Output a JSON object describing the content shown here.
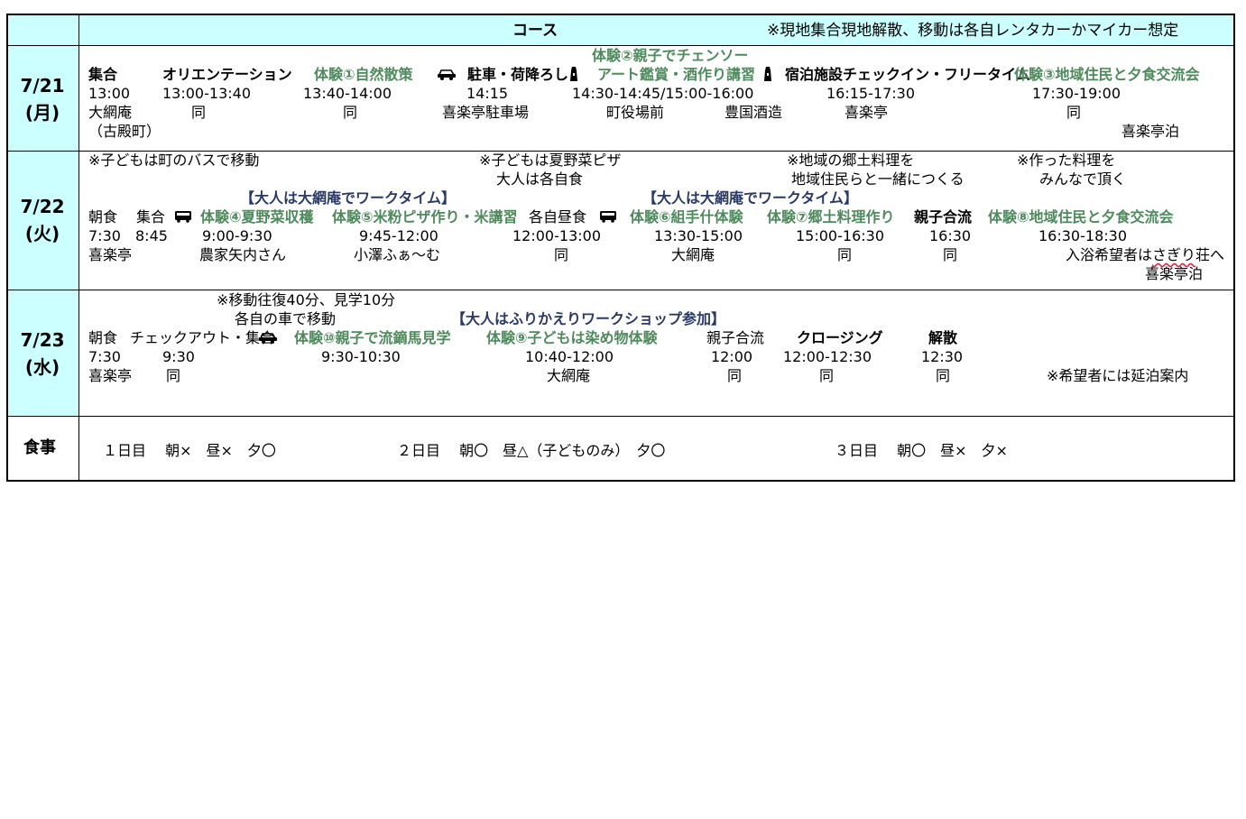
{
  "header": {
    "course_label": "コース",
    "note": "※現地集合現地解散、移動は各自レンタカーかマイカー想定"
  },
  "days": [
    {
      "date": "7/21",
      "weekday": "(月)"
    },
    {
      "date": "7/22",
      "weekday": "(火)"
    },
    {
      "date": "7/23",
      "weekday": "(水)"
    }
  ],
  "day1": {
    "top_label": "体験②親子でチェンソー",
    "items": [
      "集合",
      "オリエンテーション",
      "体験①自然散策",
      "駐車・荷降ろし",
      "アート鑑賞・酒作り講習",
      "宿泊施設チェックイン・フリータイム",
      "体験③地域住民と夕食交流会"
    ],
    "times": [
      "13:00",
      "13:00-13:40",
      "13:40-14:00",
      "14:15",
      "14:30-14:45/15:00-16:00",
      "16:15-17:30",
      "17:30-19:00"
    ],
    "places": [
      "大網庵",
      "同",
      "同",
      "喜楽亭駐車場",
      "町役場前",
      "豊国酒造",
      "喜楽亭",
      "同"
    ],
    "place_sub": "（古殿町）",
    "stay": "喜楽亭泊"
  },
  "day2": {
    "notes": [
      "※子どもは町のバスで移動",
      "※子どもは夏野菜ピザ",
      "大人は各自食",
      "※地域の郷土料理を",
      "地域住民らと一緒につくる",
      "※作った料理を",
      "みんなで頂く"
    ],
    "adult_notes": [
      "【大人は大網庵でワークタイム】",
      "【大人は大網庵でワークタイム】"
    ],
    "items": [
      "朝食",
      "集合",
      "体験④夏野菜収穫",
      "体験⑤米粉ピザ作り・米講習",
      "各自昼食",
      "体験⑥組手什体験",
      "体験⑦郷土料理作り",
      "親子合流",
      "体験⑧地域住民と夕食交流会"
    ],
    "times": [
      "7:30",
      "8:45",
      "9:00-9:30",
      "9:45-12:00",
      "12:00-13:00",
      "13:30-15:00",
      "15:00-16:30",
      "16:30",
      "16:30-18:30"
    ],
    "places": [
      "喜楽亭",
      "農家矢内さん",
      "小澤ふぁ～む",
      "同",
      "大網庵",
      "同",
      "同"
    ],
    "bath_prefix": "入浴希望者は",
    "bath_wavy": "さぎり",
    "bath_suffix": "荘へ",
    "stay": "喜楽亭泊"
  },
  "day3": {
    "notes": [
      "※移動往復40分、見学10分",
      "各自の車で移動"
    ],
    "adult_note": "【大人はふりかえりワークショップ参加】",
    "items": [
      "朝食",
      "チェックアウト・集合",
      "体験⑩親子で流鏑馬見学",
      "体験⑨子どもは染め物体験",
      "親子合流",
      "クロージング",
      "解散"
    ],
    "times": [
      "7:30",
      "9:30",
      "9:30-10:30",
      "10:40-12:00",
      "12:00",
      "12:00-12:30",
      "12:30"
    ],
    "places": [
      "喜楽亭",
      "同",
      "大網庵",
      "同",
      "同",
      "同"
    ],
    "extend_note": "※希望者には延泊案内"
  },
  "meals": {
    "label": "食事",
    "day1": "１日目　 朝×　昼×　夕〇",
    "day2": "２日目　 朝〇　昼△（子どものみ）　夕〇",
    "day3": "３日目　 朝〇　昼×　夕×"
  },
  "icons": [
    "car-icon",
    "bus-icon",
    "tower-icon"
  ],
  "colors": {
    "header_bg": "#ccffff",
    "date_bg": "#ccffff",
    "green_text": "#4e8a5c",
    "navy_text": "#2a3a66"
  }
}
